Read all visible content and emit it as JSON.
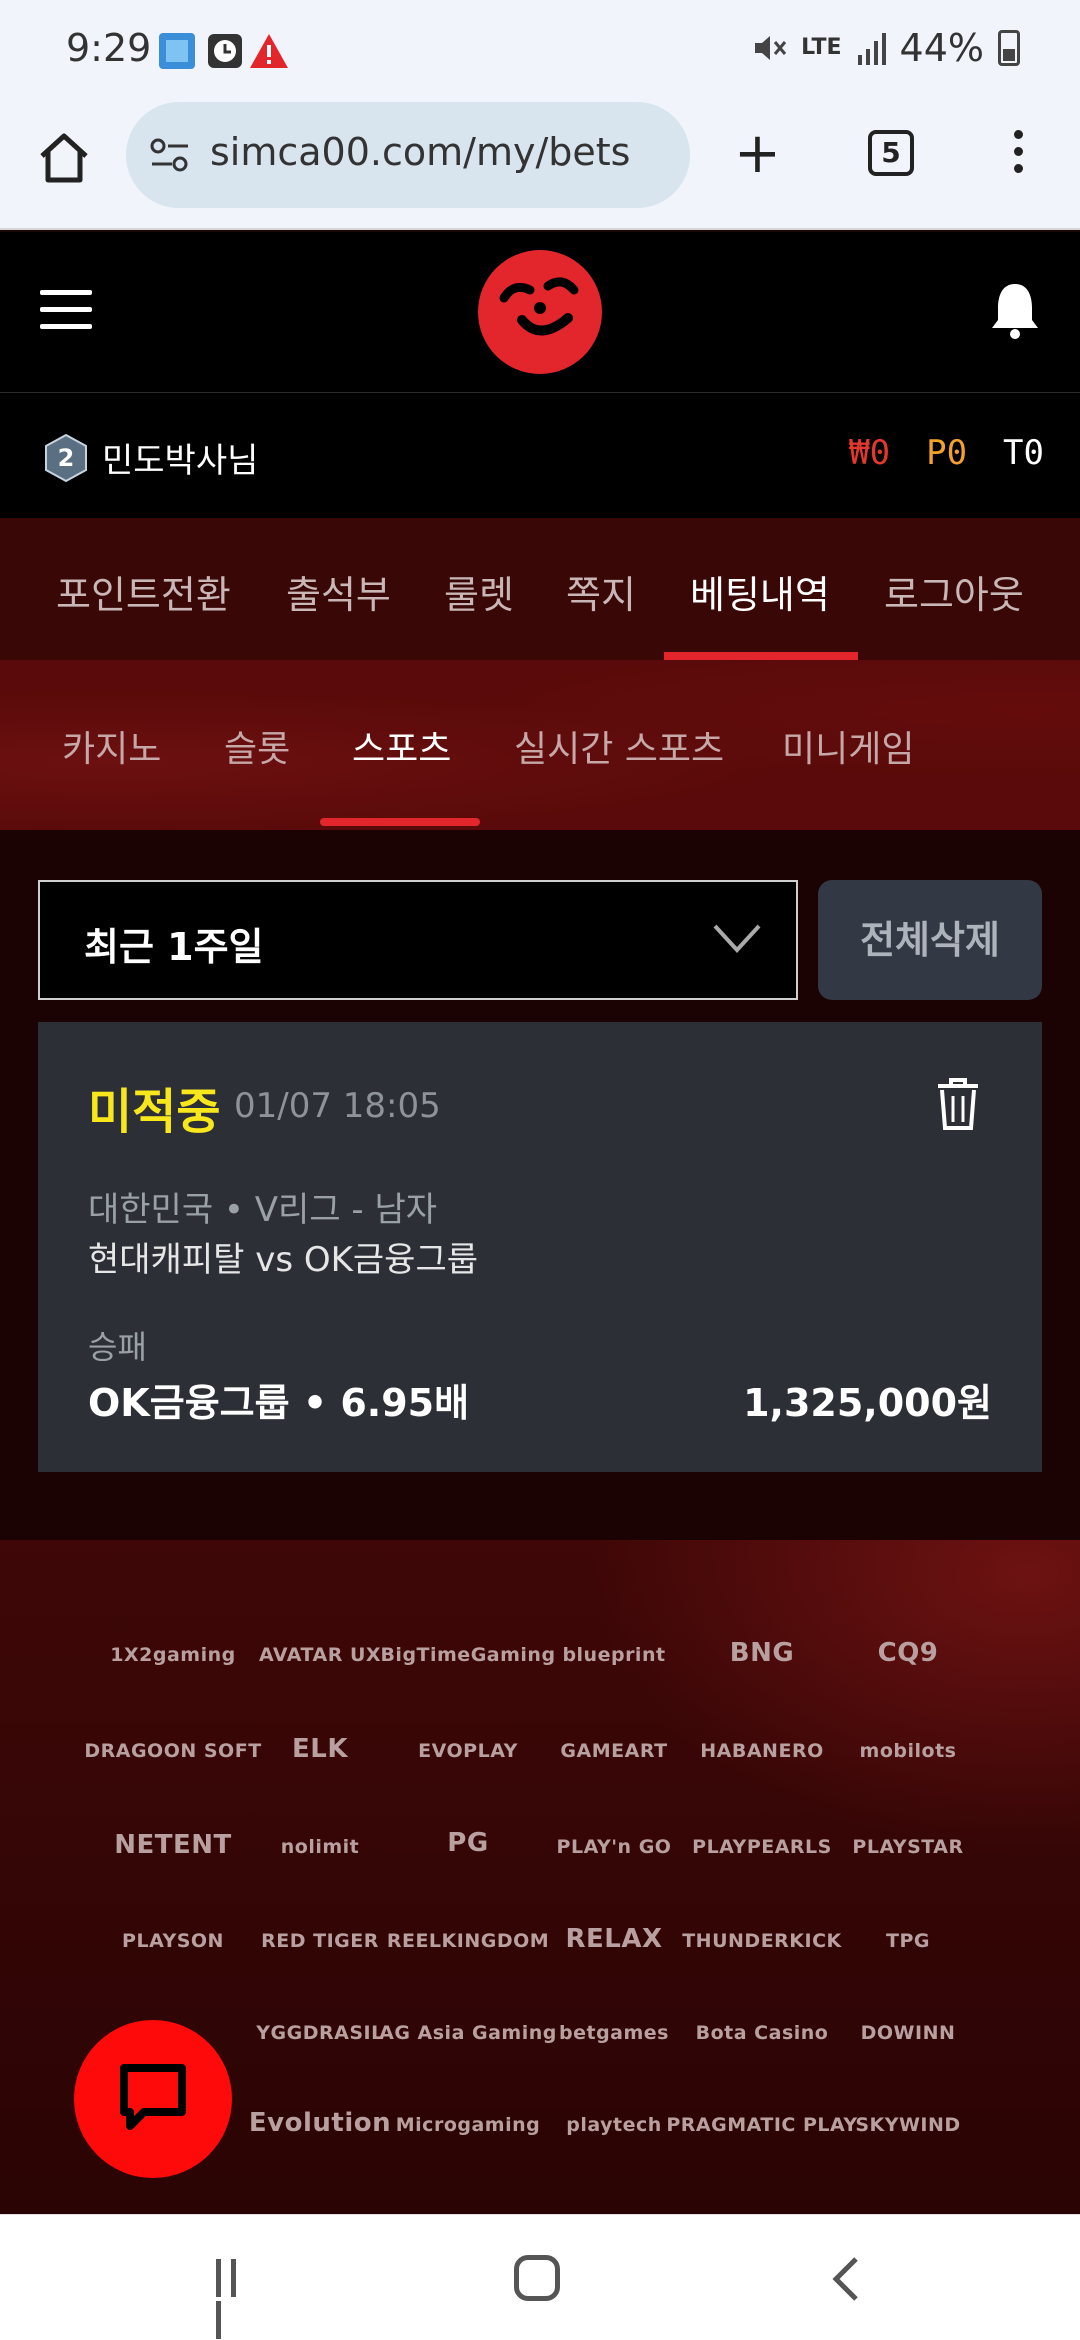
{
  "status_bar": {
    "time": "9:29",
    "lte": "LTE",
    "battery": "44%",
    "icons": [
      "app-notification-icon",
      "clock-icon",
      "warning-icon",
      "mute-icon",
      "lte-icon",
      "signal-icon",
      "battery-icon"
    ]
  },
  "browser": {
    "url": "simca00.com/my/bets",
    "tab_count": "5",
    "icons": [
      "home-icon",
      "site-settings-icon",
      "new-tab-icon",
      "tabs-icon",
      "more-menu-icon"
    ]
  },
  "header": {
    "icons": [
      "hamburger-menu-icon",
      "site-logo",
      "notification-bell-icon"
    ],
    "logo_color": "#e3262b"
  },
  "user": {
    "level": "2",
    "name": "민도박사님",
    "won_balance": "₩0",
    "point_balance": "P0",
    "t_balance": "T0"
  },
  "main_nav": {
    "items": [
      "포인트전환",
      "출석부",
      "룰렛",
      "쪽지",
      "베팅내역",
      "로그아웃"
    ],
    "active": "베팅내역"
  },
  "sub_nav": {
    "items": [
      "카지노",
      "슬롯",
      "스포츠",
      "실시간 스포츠",
      "미니게임"
    ],
    "active": "스포츠"
  },
  "filter": {
    "period": "최근 1주일",
    "delete_all": "전체삭제"
  },
  "bet": {
    "status": "미적중",
    "datetime": "01/07 18:05",
    "league": "대한민국 • V리그 - 남자",
    "match": "현대캐피탈 vs OK금융그룹",
    "market": "승패",
    "pick": "OK금융그룹 • 6.95배",
    "amount": "1,325,000원"
  },
  "providers": [
    "1X2gaming",
    "AVATAR UX",
    "BigTimeGaming",
    "blueprint",
    "BNG",
    "CQ9",
    "DRAGOON SOFT",
    "ELK",
    "EVOPLAY",
    "GAMEART",
    "HABANERO",
    "mobilots",
    "NETENT",
    "nolimit",
    "PG",
    "PLAY'n GO",
    "PLAYPEARLS",
    "PLAYSTAR",
    "PLAYSON",
    "RED TIGER",
    "REELKINGDOM",
    "RELAX",
    "THUNDERKICK",
    "TPG",
    "YGGDRASIL",
    "AG Asia Gaming",
    "betgames",
    "Bota Casino",
    "DOWINN",
    "Evolution",
    "Microgaming",
    "playtech",
    "PRAGMATIC PLAY",
    "SKYWIND"
  ],
  "colors": {
    "accent": "#e3262b",
    "status_lost": "#f8e71a",
    "card_bg": "#2c2f36",
    "chat_button": "#ff0a0a"
  }
}
